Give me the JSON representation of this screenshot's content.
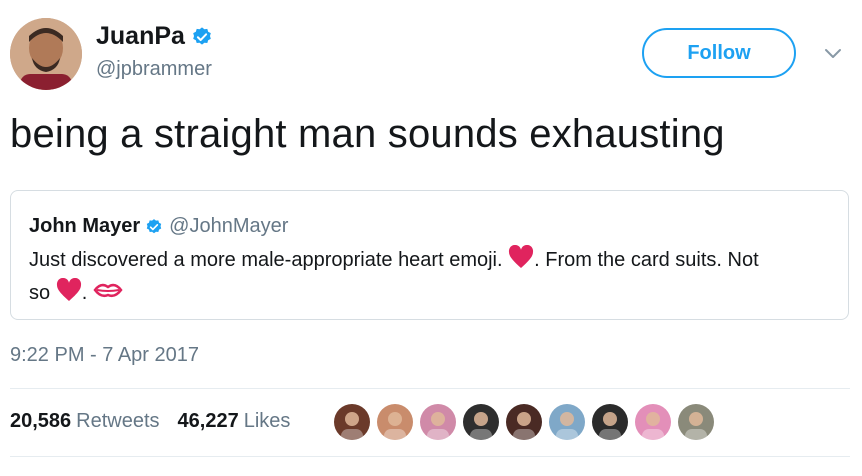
{
  "author": {
    "display_name": "JuanPa",
    "handle": "@jpbrammer",
    "verified_icon": "verified-badge-icon"
  },
  "follow_button": {
    "label": "Follow"
  },
  "tweet": {
    "text": "being a straight man sounds exhausting",
    "timestamp": "9:22 PM - 7 Apr 2017"
  },
  "quoted_tweet": {
    "display_name": "John Mayer",
    "handle": "@JohnMayer",
    "text_part1": "Just discovered a more male-appropriate heart emoji. ",
    "text_part2": ". From the card suits. Not",
    "text_part3": "so ",
    "text_part4": ". "
  },
  "stats": {
    "retweets_count": "20,586",
    "retweets_label": "Retweets",
    "likes_count": "46,227",
    "likes_label": "Likes"
  },
  "colors": {
    "accent": "#1da1f2",
    "secondary_text": "#657786",
    "heart_red": "#e0245e"
  },
  "likers": [
    {
      "name": "liker-avatar-1",
      "color": "#6b3a2a"
    },
    {
      "name": "liker-avatar-2",
      "color": "#c98c6c"
    },
    {
      "name": "liker-avatar-3",
      "color": "#d08aa8"
    },
    {
      "name": "liker-avatar-4",
      "color": "#2e2e2e"
    },
    {
      "name": "liker-avatar-5",
      "color": "#4a2a24"
    },
    {
      "name": "liker-avatar-6",
      "color": "#7fa8c8"
    },
    {
      "name": "liker-avatar-7",
      "color": "#2b2b2b"
    },
    {
      "name": "liker-avatar-8",
      "color": "#e38fb9"
    },
    {
      "name": "liker-avatar-9",
      "color": "#8a8a7a"
    }
  ]
}
